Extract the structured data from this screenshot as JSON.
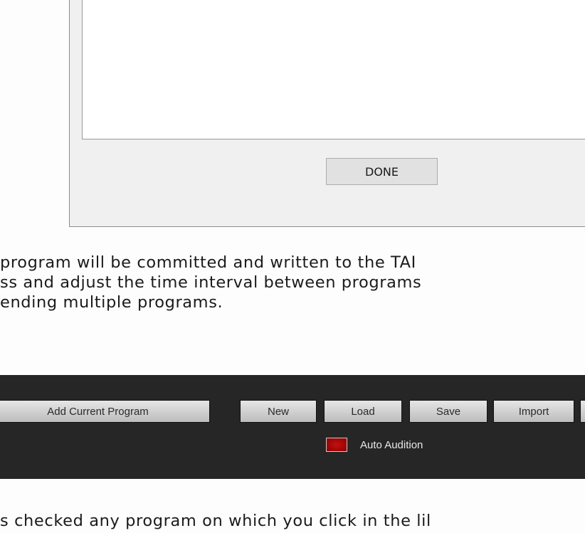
{
  "dialog": {
    "done_label": "DONE"
  },
  "instructions": {
    "para1": [
      "program will be committed and written to the TAI",
      "ss and adjust the time interval between programs",
      "ending multiple programs."
    ],
    "para2": [
      "s checked any program on which you click in the lil"
    ]
  },
  "toolbar": {
    "add_current_program_label": "Add Current Program",
    "new_label": "New",
    "load_label": "Load",
    "save_label": "Save",
    "import_label": "Import",
    "auto_audition_label": "Auto Audition",
    "auto_audition_state": "on",
    "led_color": "#b30000",
    "background_color": "#262626"
  }
}
